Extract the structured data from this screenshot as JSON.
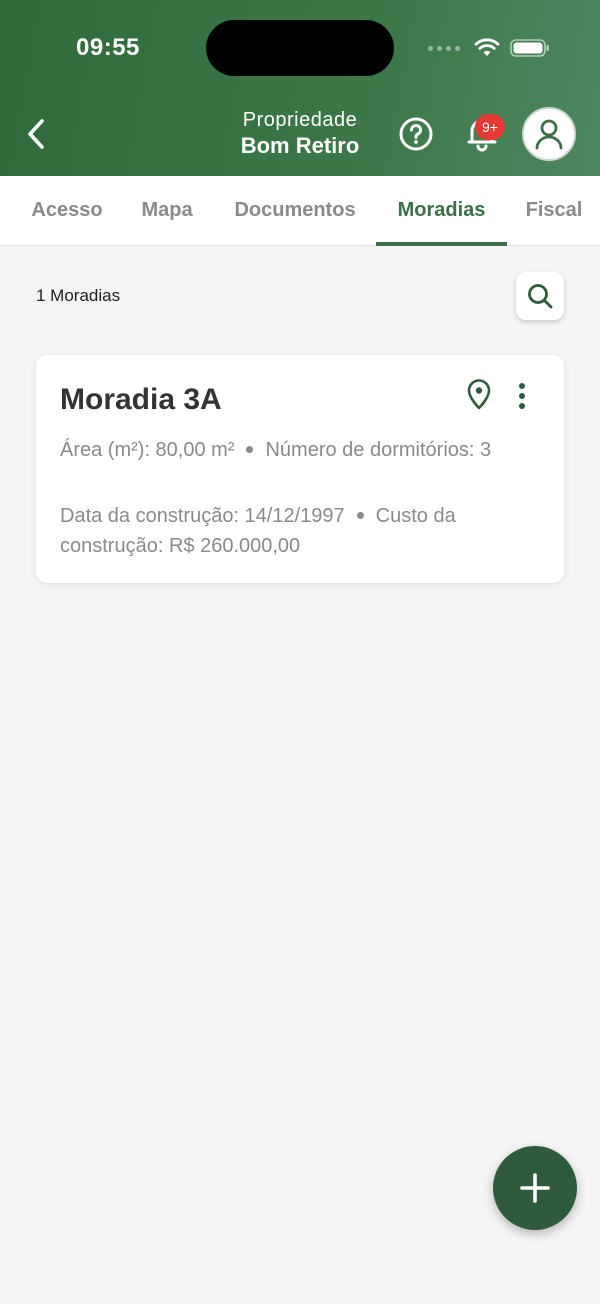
{
  "status_bar": {
    "time": "09:55"
  },
  "header": {
    "subtitle": "Propriedade",
    "title": "Bom Retiro",
    "notification_badge": "9+",
    "colors": {
      "primary": "#3c6e49",
      "badge": "#e53935"
    }
  },
  "tabs": [
    {
      "label": "Acesso"
    },
    {
      "label": "Mapa"
    },
    {
      "label": "Documentos"
    },
    {
      "label": "Moradias",
      "active": true
    },
    {
      "label": "Fiscal"
    }
  ],
  "list": {
    "count_label": "1 Moradias",
    "items": [
      {
        "title": "Moradia 3A",
        "area_text": "Área (m²): 80,00 m²",
        "bedrooms_text": "Número de dormitórios: 3",
        "build_date_text": "Data da construção: 14/12/1997",
        "build_cost_text": "Custo da construção: R$ 260.000,00"
      }
    ]
  },
  "icons": {
    "back": "chevron-left-icon",
    "help": "help-circle-icon",
    "notifications": "bell-icon",
    "profile": "user-icon",
    "search": "search-icon",
    "location": "map-pin-icon",
    "more": "more-vertical-icon",
    "add": "plus-icon"
  }
}
